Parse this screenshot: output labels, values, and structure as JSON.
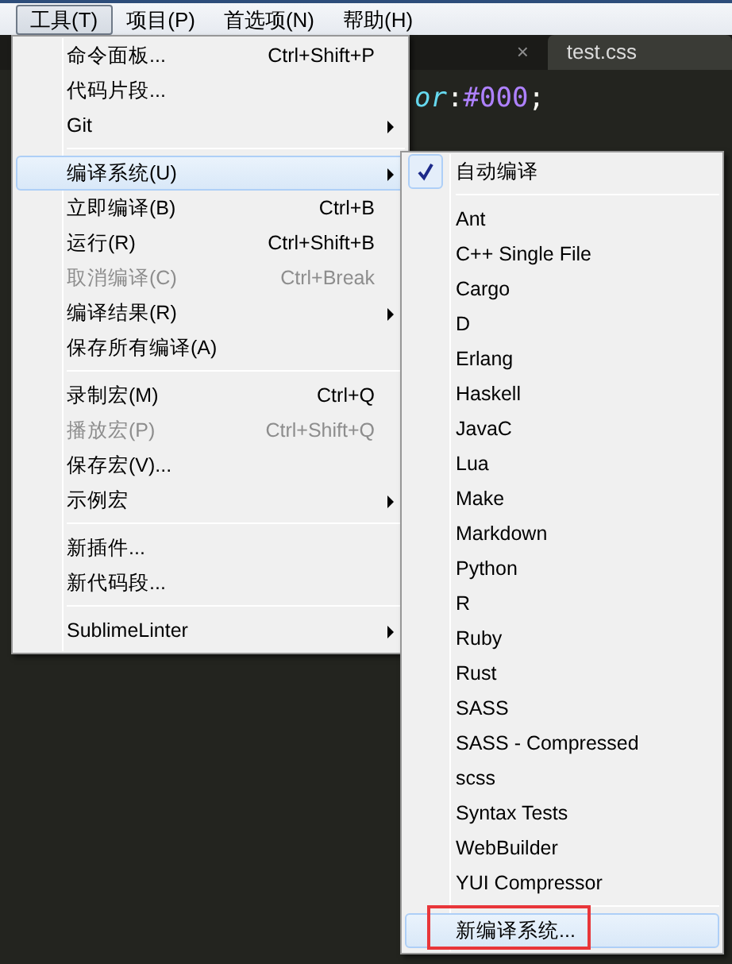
{
  "menu_bar": [
    {
      "label": "工具(T)",
      "selected": true
    },
    {
      "label": "项目(P)",
      "selected": false
    },
    {
      "label": "首选项(N)",
      "selected": false
    },
    {
      "label": "帮助(H)",
      "selected": false
    }
  ],
  "editor": {
    "tab_close": "×",
    "tab_label": "test.css",
    "code_tokens": [
      {
        "kind": "property",
        "text": "or"
      },
      {
        "kind": "punct",
        "text": ":"
      },
      {
        "kind": "value",
        "text": "#000"
      },
      {
        "kind": "punct",
        "text": ";"
      }
    ]
  },
  "main_menu": [
    {
      "kind": "item",
      "label": "命令面板...",
      "shortcut": "Ctrl+Shift+P",
      "submenu": false,
      "disabled": false,
      "selected": false
    },
    {
      "kind": "item",
      "label": "代码片段...",
      "submenu": false,
      "disabled": false,
      "selected": false
    },
    {
      "kind": "item",
      "label": "Git",
      "submenu": true,
      "disabled": false,
      "selected": false
    },
    {
      "kind": "separator"
    },
    {
      "kind": "item",
      "label": "编译系统(U)",
      "submenu": true,
      "disabled": false,
      "selected": true
    },
    {
      "kind": "item",
      "label": "立即编译(B)",
      "shortcut": "Ctrl+B",
      "submenu": false,
      "disabled": false,
      "selected": false
    },
    {
      "kind": "item",
      "label": "运行(R)",
      "shortcut": "Ctrl+Shift+B",
      "submenu": false,
      "disabled": false,
      "selected": false
    },
    {
      "kind": "item",
      "label": "取消编译(C)",
      "shortcut": "Ctrl+Break",
      "submenu": false,
      "disabled": true,
      "selected": false
    },
    {
      "kind": "item",
      "label": "编译结果(R)",
      "submenu": true,
      "disabled": false,
      "selected": false
    },
    {
      "kind": "item",
      "label": "保存所有编译(A)",
      "submenu": false,
      "disabled": false,
      "selected": false
    },
    {
      "kind": "separator"
    },
    {
      "kind": "item",
      "label": "录制宏(M)",
      "shortcut": "Ctrl+Q",
      "submenu": false,
      "disabled": false,
      "selected": false
    },
    {
      "kind": "item",
      "label": "播放宏(P)",
      "shortcut": "Ctrl+Shift+Q",
      "submenu": false,
      "disabled": true,
      "selected": false
    },
    {
      "kind": "item",
      "label": "保存宏(V)...",
      "submenu": false,
      "disabled": false,
      "selected": false
    },
    {
      "kind": "item",
      "label": "示例宏",
      "submenu": true,
      "disabled": false,
      "selected": false
    },
    {
      "kind": "separator"
    },
    {
      "kind": "item",
      "label": "新插件...",
      "submenu": false,
      "disabled": false,
      "selected": false
    },
    {
      "kind": "item",
      "label": "新代码段...",
      "submenu": false,
      "disabled": false,
      "selected": false
    },
    {
      "kind": "separator"
    },
    {
      "kind": "item",
      "label": "SublimeLinter",
      "submenu": true,
      "disabled": false,
      "selected": false
    }
  ],
  "build_submenu": [
    {
      "kind": "check",
      "label": "自动编译",
      "checked": true,
      "selected": false,
      "outlined": false
    },
    {
      "kind": "separator"
    },
    {
      "kind": "item",
      "label": "Ant",
      "selected": false,
      "outlined": false
    },
    {
      "kind": "item",
      "label": "C++ Single File",
      "selected": false,
      "outlined": false
    },
    {
      "kind": "item",
      "label": "Cargo",
      "selected": false,
      "outlined": false
    },
    {
      "kind": "item",
      "label": "D",
      "selected": false,
      "outlined": false
    },
    {
      "kind": "item",
      "label": "Erlang",
      "selected": false,
      "outlined": false
    },
    {
      "kind": "item",
      "label": "Haskell",
      "selected": false,
      "outlined": false
    },
    {
      "kind": "item",
      "label": "JavaC",
      "selected": false,
      "outlined": false
    },
    {
      "kind": "item",
      "label": "Lua",
      "selected": false,
      "outlined": false
    },
    {
      "kind": "item",
      "label": "Make",
      "selected": false,
      "outlined": false
    },
    {
      "kind": "item",
      "label": "Markdown",
      "selected": false,
      "outlined": false
    },
    {
      "kind": "item",
      "label": "Python",
      "selected": false,
      "outlined": false
    },
    {
      "kind": "item",
      "label": "R",
      "selected": false,
      "outlined": false
    },
    {
      "kind": "item",
      "label": "Ruby",
      "selected": false,
      "outlined": false
    },
    {
      "kind": "item",
      "label": "Rust",
      "selected": false,
      "outlined": false
    },
    {
      "kind": "item",
      "label": "SASS",
      "selected": false,
      "outlined": false
    },
    {
      "kind": "item",
      "label": "SASS - Compressed",
      "selected": false,
      "outlined": false
    },
    {
      "kind": "item",
      "label": "scss",
      "selected": false,
      "outlined": false
    },
    {
      "kind": "item",
      "label": "Syntax Tests",
      "selected": false,
      "outlined": false
    },
    {
      "kind": "item",
      "label": "WebBuilder",
      "selected": false,
      "outlined": false
    },
    {
      "kind": "item",
      "label": "YUI Compressor",
      "selected": false,
      "outlined": false
    },
    {
      "kind": "separator"
    },
    {
      "kind": "item",
      "label": "新编译系统...",
      "selected": true,
      "outlined": true
    }
  ]
}
